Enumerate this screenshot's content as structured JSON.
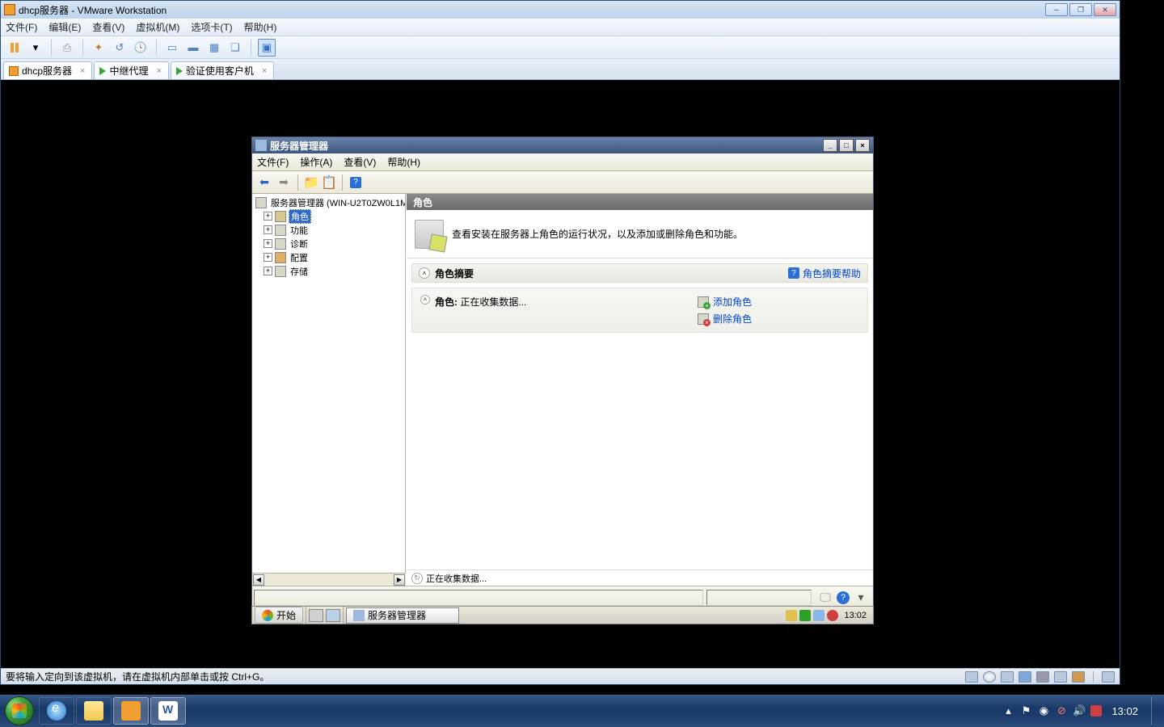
{
  "vmware": {
    "title": "dhcp服务器 - VMware Workstation",
    "menu": {
      "file": "文件(F)",
      "edit": "编辑(E)",
      "view": "查看(V)",
      "vm": "虚拟机(M)",
      "tabs": "选项卡(T)",
      "help": "帮助(H)"
    },
    "tabs": [
      {
        "label": "dhcp服务器"
      },
      {
        "label": "中继代理"
      },
      {
        "label": "验证使用客户机"
      }
    ],
    "status": "要将输入定向到该虚拟机，请在虚拟机内部单击或按 Ctrl+G。"
  },
  "server": {
    "title": "服务器管理器",
    "menu": {
      "file": "文件(F)",
      "action": "操作(A)",
      "view": "查看(V)",
      "help": "帮助(H)"
    },
    "tree": {
      "root": "服务器管理器 (WIN-U2T0ZW0L1M",
      "items": [
        "角色",
        "功能",
        "诊断",
        "配置",
        "存储"
      ]
    },
    "content": {
      "header": "角色",
      "banner": "查看安装在服务器上角色的运行状况，以及添加或删除角色和功能。",
      "summary_title": "角色摘要",
      "summary_help": "角色摘要帮助",
      "roles_label": "角色:",
      "roles_status": "正在收集数据...",
      "add_role": "添加角色",
      "del_role": "删除角色",
      "status_text": "正在收集数据..."
    }
  },
  "inner_taskbar": {
    "start": "开始",
    "task": "服务器管理器",
    "clock": "13:02"
  },
  "host": {
    "clock": "13:02"
  }
}
